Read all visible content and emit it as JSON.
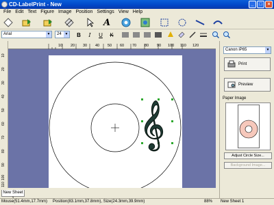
{
  "window": {
    "title": "CD-LabelPrint - New"
  },
  "menu": [
    "File",
    "Edit",
    "Text",
    "Figure",
    "Image",
    "Position",
    "Settings",
    "View",
    "Help"
  ],
  "format_bar": {
    "font": "Arial",
    "size": "24",
    "bold": "B",
    "italic": "I",
    "underline": "U",
    "strike": "K"
  },
  "ruler_ticks": [
    "10",
    "20",
    "30",
    "40",
    "50",
    "60",
    "70",
    "80",
    "90",
    "100",
    "110",
    "120"
  ],
  "vruler_ticks": [
    "10",
    "20",
    "30",
    "40",
    "50",
    "60",
    "70",
    "80",
    "90",
    "100",
    "110"
  ],
  "right_panel": {
    "printer": "Canon iP65",
    "print_label": "Print",
    "preview_label": "Preview",
    "paper_image_label": "Paper Image",
    "adjust_label": "Adjust Circle Size...",
    "background_label": "Background Image..."
  },
  "sheet_tab": "New Sheet 1",
  "status": {
    "mouse": "Mouse(51.4mm,17.7mm)",
    "position": "Position(83.1mm,37.8mm), Size(24.3mm,39.9mm)",
    "zoom": "88%",
    "sheet": "New Sheet 1"
  },
  "icons": {
    "treble_clef": "𝄞"
  }
}
